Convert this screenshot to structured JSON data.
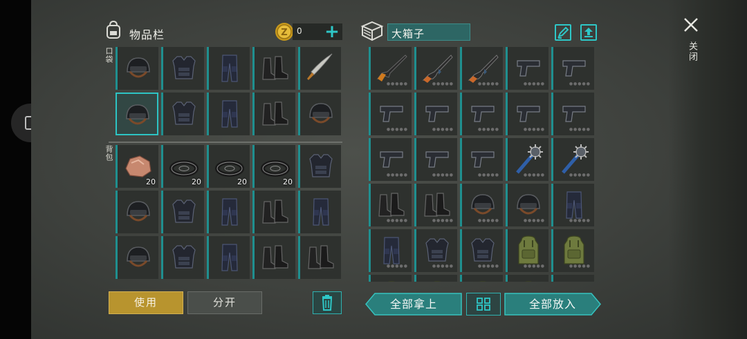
{
  "inventory": {
    "title": "物品栏",
    "coin_count": "0",
    "pocket_tag": "口袋",
    "backpack_tag": "背包",
    "pocket_items": [
      {
        "icon": "helmet-icon",
        "qty": ""
      },
      {
        "icon": "armor-vest-icon",
        "qty": ""
      },
      {
        "icon": "tactical-pants-icon",
        "qty": ""
      },
      {
        "icon": "boots-icon",
        "qty": ""
      },
      {
        "icon": "machete-icon",
        "qty": ""
      },
      {
        "icon": "helmet-icon",
        "qty": "",
        "selected": true
      },
      {
        "icon": "armor-vest-icon",
        "qty": ""
      },
      {
        "icon": "tactical-pants-icon",
        "qty": ""
      },
      {
        "icon": "boots-icon",
        "qty": ""
      },
      {
        "icon": "helmet-icon",
        "qty": ""
      }
    ],
    "backpack_items": [
      {
        "icon": "ore-rock-icon",
        "qty": "20"
      },
      {
        "icon": "tape-roll-icon",
        "qty": "20"
      },
      {
        "icon": "tape-roll-icon",
        "qty": "20"
      },
      {
        "icon": "tape-roll-icon",
        "qty": "20"
      },
      {
        "icon": "armor-vest-icon",
        "qty": ""
      },
      {
        "icon": "helmet-icon",
        "qty": ""
      },
      {
        "icon": "armor-vest-icon",
        "qty": ""
      },
      {
        "icon": "tactical-pants-icon",
        "qty": ""
      },
      {
        "icon": "boots-icon",
        "qty": ""
      },
      {
        "icon": "tactical-pants-icon",
        "qty": ""
      },
      {
        "icon": "helmet-icon",
        "qty": ""
      },
      {
        "icon": "armor-vest-icon",
        "qty": ""
      },
      {
        "icon": "tactical-pants-icon",
        "qty": ""
      },
      {
        "icon": "boots-icon",
        "qty": ""
      },
      {
        "icon": "boots-icon",
        "qty": ""
      }
    ]
  },
  "container": {
    "title": "大箱子",
    "items": [
      {
        "icon": "shotgun-icon"
      },
      {
        "icon": "assault-rifle-icon"
      },
      {
        "icon": "assault-rifle-icon"
      },
      {
        "icon": "pistol-icon"
      },
      {
        "icon": "pistol-icon"
      },
      {
        "icon": "pistol-icon"
      },
      {
        "icon": "pistol-icon"
      },
      {
        "icon": "pistol-icon"
      },
      {
        "icon": "pistol-icon"
      },
      {
        "icon": "pistol-icon"
      },
      {
        "icon": "pistol-icon"
      },
      {
        "icon": "pistol-icon"
      },
      {
        "icon": "pistol-icon"
      },
      {
        "icon": "spiked-mace-icon"
      },
      {
        "icon": "spiked-mace-icon"
      },
      {
        "icon": "boots-icon"
      },
      {
        "icon": "boots-icon"
      },
      {
        "icon": "helmet-icon"
      },
      {
        "icon": "helmet-icon"
      },
      {
        "icon": "tactical-pants-icon"
      },
      {
        "icon": "tactical-pants-icon"
      },
      {
        "icon": "armor-vest-icon"
      },
      {
        "icon": "armor-vest-icon"
      },
      {
        "icon": "backpack-icon"
      },
      {
        "icon": "backpack-icon"
      },
      {
        "icon": "backpack-icon"
      },
      {
        "icon": "backpack-icon"
      },
      {
        "icon": "backpack-icon"
      },
      {
        "icon": "backpack-icon"
      },
      {
        "icon": ""
      }
    ]
  },
  "close": {
    "label": "关闭",
    "icon": "close-icon"
  },
  "actions": {
    "use_label": "使用",
    "split_label": "分开",
    "take_all_label": "全部拿上",
    "put_all_label": "全部放入",
    "trash_icon": "trash-icon",
    "sort_icon": "grid-sort-icon"
  },
  "colors": {
    "accent_cyan": "#2ec7c7",
    "use_button": "#b8942e",
    "panel_bg": "#3c3e3b"
  }
}
